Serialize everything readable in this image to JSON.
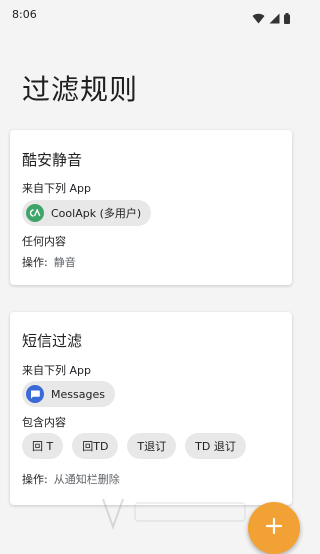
{
  "status_bar": {
    "time": "8:06",
    "icons": [
      "wifi-icon",
      "signal-icon",
      "battery-icon"
    ]
  },
  "page": {
    "title": "过滤规则"
  },
  "rules": [
    {
      "title": "酷安静音",
      "from_label": "来自下列 App",
      "app": {
        "name": "CoolApk (多用户)",
        "icon": "coolapk-icon",
        "icon_color": "#3ea56a"
      },
      "content_label": "任何内容",
      "keywords": [],
      "action_label": "操作:",
      "action_value": "静音"
    },
    {
      "title": "短信过滤",
      "from_label": "来自下列 App",
      "app": {
        "name": "Messages",
        "icon": "messages-icon",
        "icon_color": "#3a6ad6"
      },
      "content_label": "包含内容",
      "keywords": [
        "回 T",
        "回TD",
        "T退订",
        "TD 退订"
      ],
      "action_label": "操作:",
      "action_value": "从通知栏删除"
    }
  ],
  "fab": {
    "icon": "plus-icon",
    "color": "#f2a135"
  },
  "watermark": {
    "icon": "watermark-logo-icon"
  }
}
